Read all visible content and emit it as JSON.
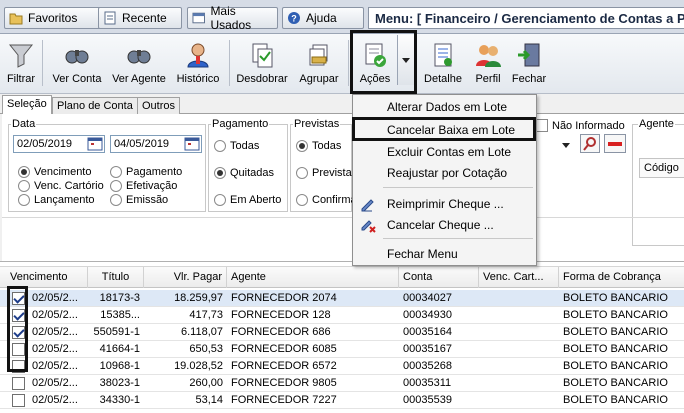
{
  "topbar": {
    "favoritos": "Favoritos",
    "recente": "Recente",
    "mais_usados": "Mais Usados",
    "ajuda": "Ajuda",
    "menu_title": "Menu: [ Financeiro / Gerenciamento de Contas a P"
  },
  "toolbar": {
    "filtrar": "Filtrar",
    "ver_conta": "Ver Conta",
    "ver_agente": "Ver Agente",
    "historico": "Histórico",
    "desdobrar": "Desdobrar",
    "agrupar": "Agrupar",
    "acoes": "Ações",
    "detalhe": "Detalhe",
    "perfil": "Perfil",
    "fechar": "Fechar"
  },
  "tabs": [
    "Seleção",
    "Plano de Conta",
    "Outros"
  ],
  "filters": {
    "data_label": "Data",
    "date_from": "02/05/2019",
    "date_to": "04/05/2019",
    "data_radios": [
      "Vencimento",
      "Pagamento",
      "Venc. Cartório",
      "Efetivação",
      "Lançamento",
      "Emissão"
    ],
    "pagamento_label": "Pagamento",
    "pagamento_radios": [
      "Todas",
      "Quitadas",
      "Em Aberto"
    ],
    "previstas_label": "Previstas",
    "previstas_radios": [
      "Todas",
      "Prevista",
      "Confirma"
    ],
    "nao_informado": "Não Informado",
    "agente_label": "Agente",
    "codigo_header": "Código"
  },
  "dropdown": {
    "items": [
      "Alterar Dados em Lote",
      "Cancelar Baixa em Lote",
      "Excluir Contas em Lote",
      "Reajustar por Cotação",
      "Reimprimir Cheque ...",
      "Cancelar Cheque ...",
      "Fechar Menu"
    ]
  },
  "grid": {
    "headers": [
      "Vencimento",
      "Título",
      "Vlr. Pagar",
      "Agente",
      "Conta",
      "Venc. Cart...",
      "Forma de Cobrança"
    ],
    "rows": [
      {
        "checked": true,
        "venc": "02/05/2...",
        "titulo": "18173-3",
        "valor": "18.259,97",
        "agente": "FORNECEDOR 2074",
        "conta": "00034027",
        "forma": "BOLETO BANCARIO"
      },
      {
        "checked": true,
        "venc": "02/05/2...",
        "titulo": "15385...",
        "valor": "417,73",
        "agente": "FORNECEDOR 128",
        "conta": "00034930",
        "forma": "BOLETO BANCARIO"
      },
      {
        "checked": true,
        "venc": "02/05/2...",
        "titulo": "550591-1",
        "valor": "6.118,07",
        "agente": "FORNECEDOR 686",
        "conta": "00035164",
        "forma": "BOLETO BANCARIO"
      },
      {
        "checked": false,
        "venc": "02/05/2...",
        "titulo": "41664-1",
        "valor": "650,53",
        "agente": "FORNECEDOR 6085",
        "conta": "00035167",
        "forma": "BOLETO BANCARIO"
      },
      {
        "checked": false,
        "venc": "02/05/2...",
        "titulo": "10968-1",
        "valor": "19.028,52",
        "agente": "FORNECEDOR 6572",
        "conta": "00035268",
        "forma": "BOLETO BANCARIO"
      },
      {
        "checked": false,
        "venc": "02/05/2...",
        "titulo": "38023-1",
        "valor": "260,00",
        "agente": "FORNECEDOR 9805",
        "conta": "00035311",
        "forma": "BOLETO BANCARIO"
      },
      {
        "checked": false,
        "venc": "02/05/2...",
        "titulo": "34330-1",
        "valor": "53,14",
        "agente": "FORNECEDOR 7227",
        "conta": "00035539",
        "forma": "BOLETO BANCARIO"
      }
    ]
  },
  "colors": {
    "accent_frame": "#111111",
    "row_selected": "#dde8f6",
    "menu_bg": "#f4f4f4"
  }
}
